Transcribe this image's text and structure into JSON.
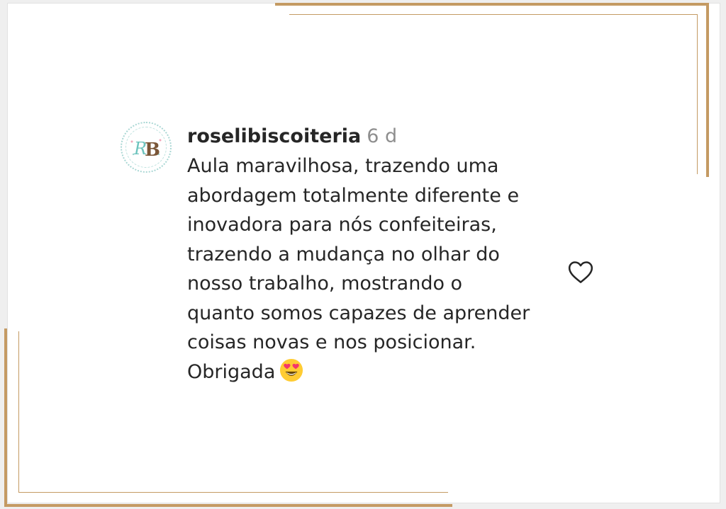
{
  "comment": {
    "username": "roselibiscoiteria",
    "time": "6 d",
    "lines": [
      "Aula maravilhosa, trazendo uma",
      "abordagem totalmente diferente e",
      "inovadora para nós confeiteiras,",
      "trazendo a mudança no olhar do",
      "nosso trabalho, mostrando o",
      "quanto somos capazes de aprender",
      "coisas novas e nos posicionar.",
      "Obrigada"
    ],
    "emoji": "heart-eyes-emoji",
    "avatar_initials": "RB",
    "like_icon": "heart-outline-icon"
  },
  "colors": {
    "frame_gold": "#c49a63",
    "text": "#262626",
    "muted": "#8e8e8e",
    "avatar_teal": "#6cc3bd",
    "avatar_brown": "#7a5638"
  }
}
